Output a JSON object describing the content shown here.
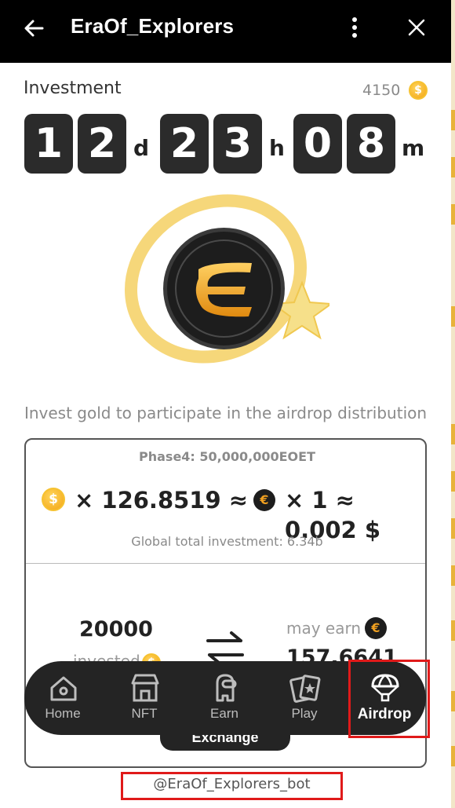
{
  "header": {
    "title": "EraOf_Explorers",
    "back_icon": "arrow-left-icon",
    "menu_icon": "more-vertical-icon",
    "close_icon": "close-icon"
  },
  "investment": {
    "label": "Investment",
    "gold_amount": "4150",
    "countdown": {
      "days": [
        "1",
        "2"
      ],
      "days_unit": "d",
      "hours": [
        "2",
        "3"
      ],
      "hours_unit": "h",
      "minutes": [
        "0",
        "8"
      ],
      "minutes_unit": "m"
    },
    "subtitle": "Invest gold to participate in the airdrop distribution"
  },
  "card": {
    "phase": "Phase4: 50,000,000EOET",
    "rate": {
      "multiplier_1": "× 126.8519 ≈",
      "multiplier_2": "× 1 ≈ 0.002 $"
    },
    "global_total": "Global total investment: 6.34b",
    "invested_amount": "20000",
    "invested_label": "invested",
    "earn_label": "may earn",
    "earn_amount": "157.6641"
  },
  "nav": {
    "items": [
      {
        "label": "Home",
        "icon": "home-icon"
      },
      {
        "label": "NFT",
        "icon": "shop-icon"
      },
      {
        "label": "Earn",
        "icon": "character-icon"
      },
      {
        "label": "Play",
        "icon": "cards-icon"
      },
      {
        "label": "Airdrop",
        "icon": "parachute-icon",
        "active": true
      }
    ],
    "exchange_label": "Exchange"
  },
  "footer": {
    "bot_handle": "@EraOf_Explorers_bot"
  },
  "colors": {
    "header_bg": "#000000",
    "digit_bg": "#2b2b2b",
    "coin_gold": "#f3a515",
    "nav_bg": "#242424",
    "highlight": "#e01a1a"
  }
}
